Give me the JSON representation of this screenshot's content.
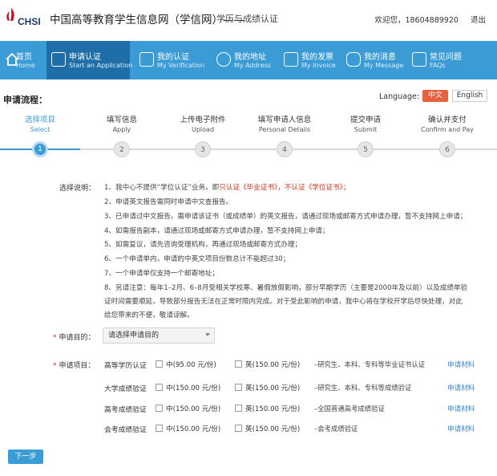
{
  "header": {
    "logo_text": "CHSI",
    "site_title": "中国高等教育学生信息网（学信网）——",
    "site_subtitle": "学历与成绩认证",
    "welcome": "欢迎您，18604889920",
    "logout": "退出"
  },
  "nav": {
    "items": [
      {
        "cn": "首页",
        "en": "Home",
        "icon": "home-icon"
      },
      {
        "cn": "申请认证",
        "en": "Start an Application",
        "icon": "checkbox-icon"
      },
      {
        "cn": "我的认证",
        "en": "My Verification",
        "icon": "document-icon"
      },
      {
        "cn": "我的地址",
        "en": "My Address",
        "icon": "map-pin-icon"
      },
      {
        "cn": "我的发票",
        "en": "My Invoice",
        "icon": "invoice-icon"
      },
      {
        "cn": "我的消息",
        "en": "My Message",
        "icon": "message-icon"
      },
      {
        "cn": "常见问题",
        "en": "FAQs",
        "icon": "faq-icon"
      }
    ]
  },
  "flow": {
    "title": "申请流程：",
    "language_label": "Language:",
    "lang_cn": "中文",
    "lang_en": "English",
    "steps": [
      {
        "cn": "选择项目",
        "en": "Select",
        "num": "1"
      },
      {
        "cn": "填写信息",
        "en": "Apply",
        "num": "2"
      },
      {
        "cn": "上传电子附件",
        "en": "Upload",
        "num": "3"
      },
      {
        "cn": "填写申请人信息",
        "en": "Personal Details",
        "num": "4"
      },
      {
        "cn": "提交申请",
        "en": "Submit",
        "num": "5"
      },
      {
        "cn": "确认并支付",
        "en": "Confirm and Pay",
        "num": "6"
      }
    ]
  },
  "notes": {
    "label": "选择说明：",
    "n1_pre": "1、我中心不提供“学位认证”业务。即",
    "n1_red": "只认证《毕业证书》，不认证《学位证书》；",
    "n2": "2、申请英文报告需同时申请中文查报告。",
    "n3": "3、已申请过中文报告，需申请该证书（或成绩单）的英文报告，请通过现场或邮寄方式申请办理，暂不支持网上申请；",
    "n4": "4、如需报告副本，请通过现场或邮寄方式申请办理，暂不支持网上申请；",
    "n5": "5、如需复议，请先咨询受理机构，再通过现场或邮寄方式办理；",
    "n6": "6、一个申请单内，申请的中英文项目份数总计不能超过30；",
    "n7": "7、一个申请单仅支持一个邮寄地址；",
    "n8a": "8、另请注意：每年1–2月、6–8月受相关学校寒、暑假放假影响，部分早期学历（主要是2000年及以前）以及成绩单验",
    "n8b": "证时间需要顺延，导致部分报告无法在正常时限内完成。对于受此影响的申请，我中心将在学校开学后尽快处理，对此",
    "n8c": "给您带来的不便，敬请谅解。"
  },
  "form": {
    "purpose_label": "申请目的：",
    "purpose_value": "请选择申请目的",
    "items_label": "申请项目：",
    "rows": [
      {
        "name": "高等学历认证",
        "cn": "中(95.00 元/份)",
        "en": "英(150.00 元/份)",
        "desc": "–研究生、本科、专科等毕业证书认证",
        "link": "申请材料"
      },
      {
        "name": "大学成绩验证",
        "cn": "中(150.00 元/份)",
        "en": "英(150.00 元/份)",
        "desc": "–研究生、本科、专科等成绩验证",
        "link": "申请材料"
      },
      {
        "name": "高考成绩验证",
        "cn": "中(150.00 元/份)",
        "en": "英(150.00 元/份)",
        "desc": "–全国普通高考成绩验证",
        "link": "申请材料"
      },
      {
        "name": "会考成绩验证",
        "cn": "中(150.00 元/份)",
        "en": "英(150.00 元/份)",
        "desc": "–会考成绩验证",
        "link": "申请材料"
      }
    ],
    "next_label": "下一步"
  },
  "colors": {
    "accent": "#3a9bd5",
    "nav_active": "#1f6ea8",
    "warn": "#d0311a",
    "lang_active": "#e8603c"
  }
}
